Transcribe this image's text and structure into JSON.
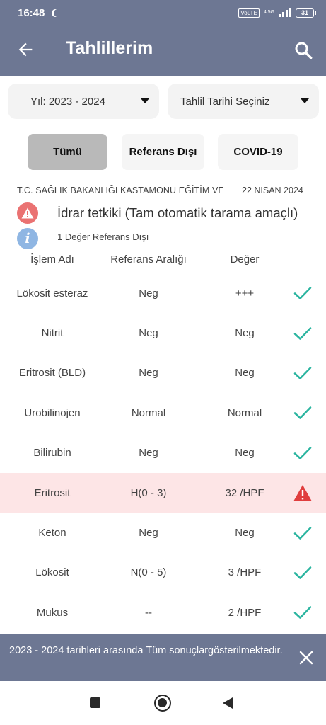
{
  "status_bar": {
    "time": "16:48",
    "volte": "VoLTE",
    "network": "4.5G",
    "battery": "31"
  },
  "app_bar": {
    "title": "Tahlillerim",
    "back_icon": "arrow-left-icon",
    "search_icon": "search-icon"
  },
  "filters": {
    "year_dropdown": "Yıl: 2023 - 2024",
    "date_dropdown": "Tahlil Tarihi Seçiniz",
    "buttons": [
      {
        "label": "Tümü",
        "selected": true
      },
      {
        "label": "Referans Dışı",
        "selected": false
      },
      {
        "label": "COVID-19",
        "selected": false
      }
    ]
  },
  "report": {
    "lab": "T.C. SAĞLIK BAKANLIĞI KASTAMONU EĞİTİM VE",
    "date": "22 NISAN 2024",
    "test_name": "İdrar tetkiki (Tam otomatik tarama amaçlı)",
    "out_of_range_summary": "1 Değer Referans Dışı",
    "info_icon_letter": "i"
  },
  "table": {
    "headers": [
      "İşlem Adı",
      "Referans Aralığı",
      "Değer"
    ],
    "rows": [
      {
        "name": "Lökosit esteraz",
        "range": "Neg",
        "value": "+++",
        "status": "ok"
      },
      {
        "name": "Nitrit",
        "range": "Neg",
        "value": "Neg",
        "status": "ok"
      },
      {
        "name": "Eritrosit (BLD)",
        "range": "Neg",
        "value": "Neg",
        "status": "ok"
      },
      {
        "name": "Urobilinojen",
        "range": "Normal",
        "value": "Normal",
        "status": "ok"
      },
      {
        "name": "Bilirubin",
        "range": "Neg",
        "value": "Neg",
        "status": "ok"
      },
      {
        "name": "Eritrosit",
        "range": "H(0 - 3)",
        "value": "32 /HPF",
        "status": "warning"
      },
      {
        "name": "Keton",
        "range": "Neg",
        "value": "Neg",
        "status": "ok"
      },
      {
        "name": "Lökosit",
        "range": "N(0 - 5)",
        "value": "3 /HPF",
        "status": "ok"
      },
      {
        "name": "Mukus",
        "range": "--",
        "value": "2 /HPF",
        "status": "ok"
      }
    ]
  },
  "toast": {
    "message": "2023 - 2024 tarihleri arasında Tüm sonuçlargösterilmektedir."
  },
  "colors": {
    "header": "#6d7793",
    "check": "#2bb5a0",
    "warning": "#e03e3e",
    "flag_row": "#fde5e6"
  }
}
